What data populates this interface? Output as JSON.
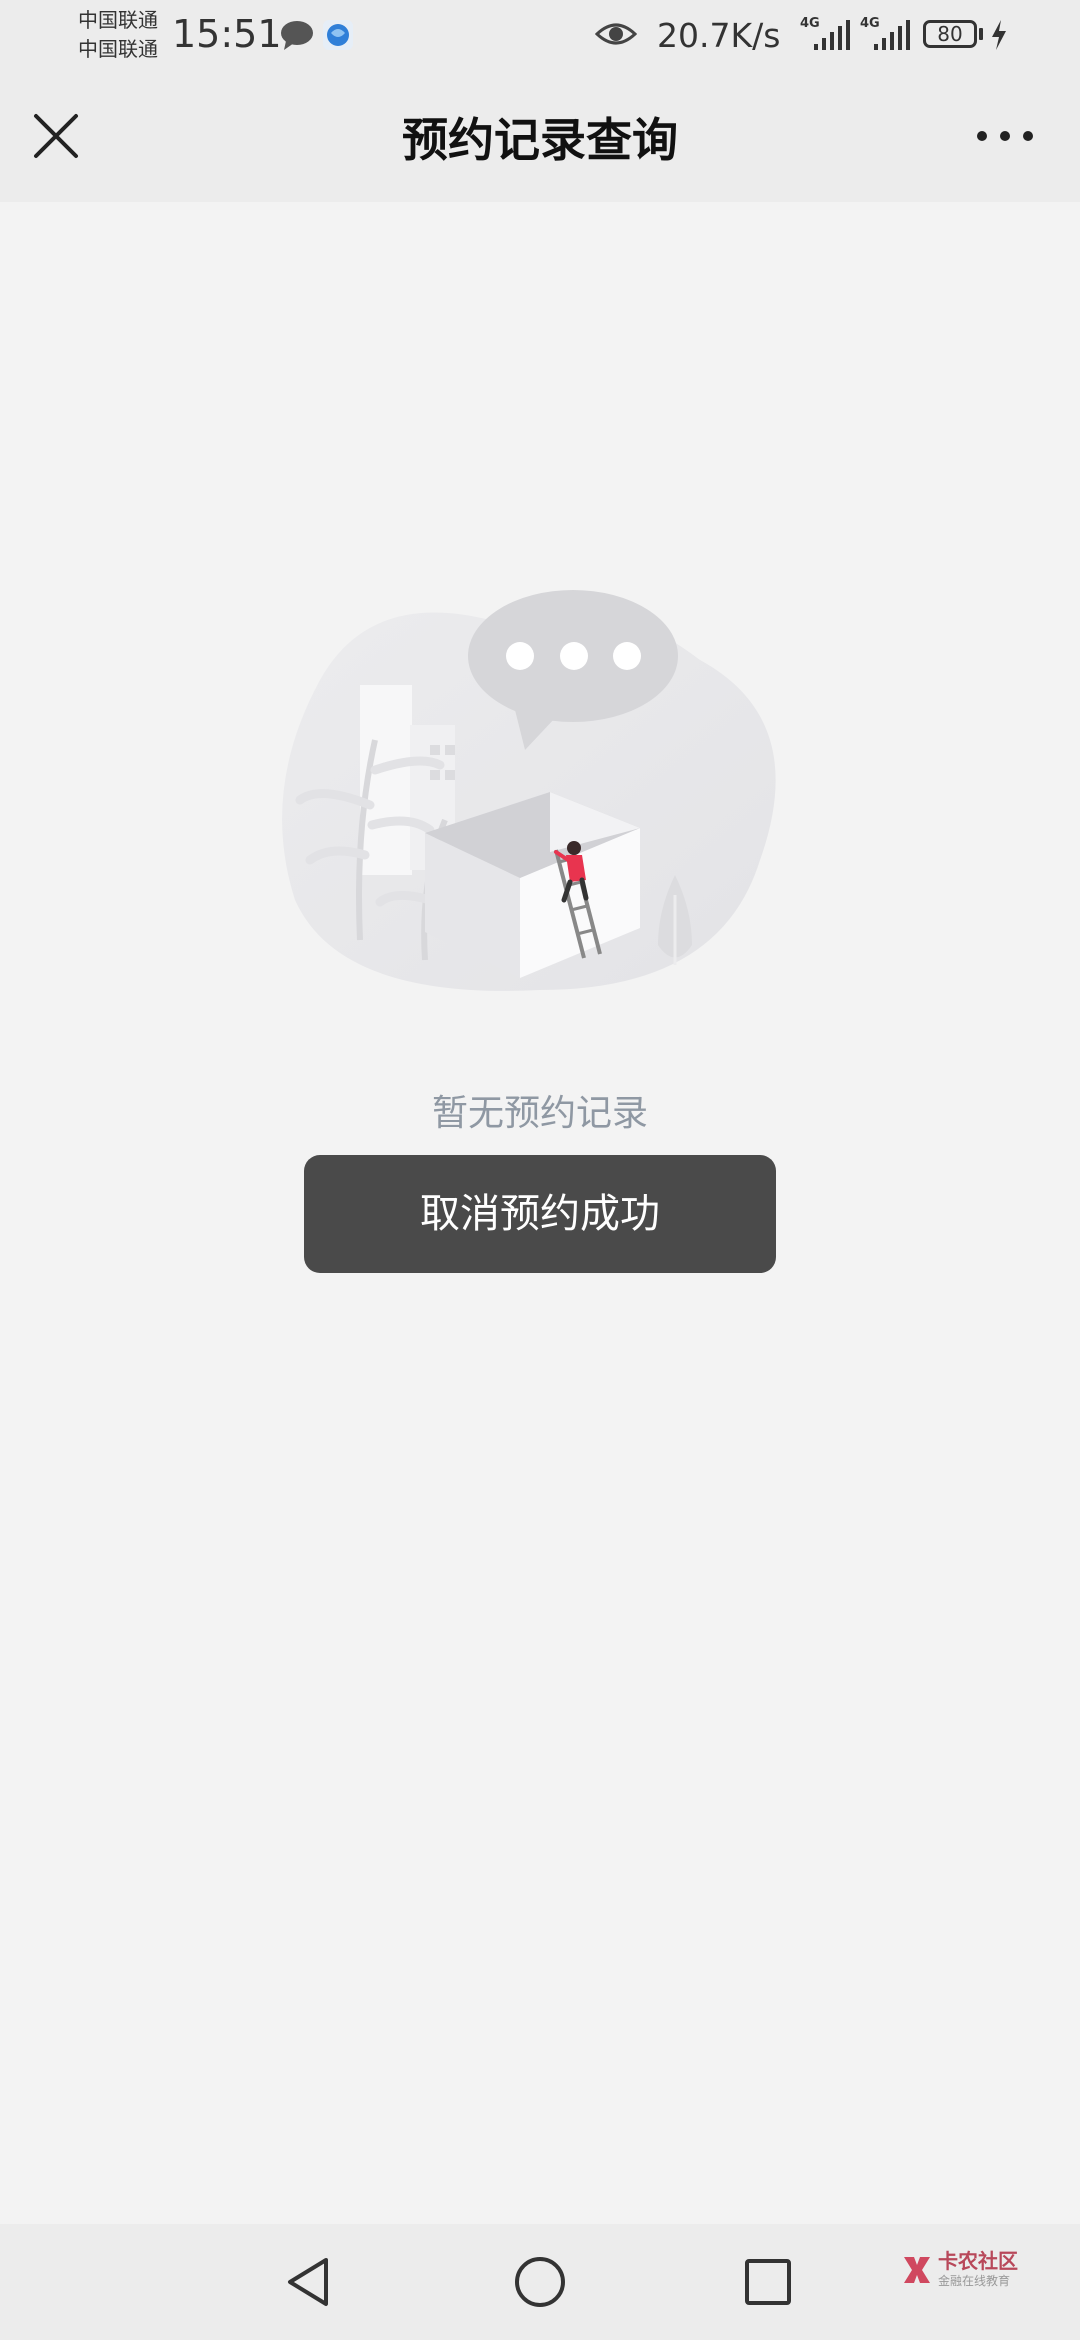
{
  "status_bar": {
    "carrier_1": "中国联通",
    "carrier_2": "中国联通",
    "time": "15:51",
    "network_speed": "20.7K/s",
    "signal_1_label": "4G",
    "signal_2_label": "4G",
    "battery_level": "80",
    "icons": [
      "message-bubble-icon",
      "browser-app-icon",
      "eye-icon",
      "signal-icon",
      "signal-icon",
      "battery-icon",
      "charging-icon"
    ]
  },
  "header": {
    "title": "预约记录查询",
    "close_icon": "close-icon",
    "more_icon": "more-dots-icon"
  },
  "main": {
    "empty_text": "暂无预约记录",
    "illustration": "empty-state-illustration"
  },
  "toast": {
    "message": "取消预约成功"
  },
  "bottom_nav": {
    "icons": [
      "back-triangle-icon",
      "home-circle-icon",
      "recents-square-icon"
    ],
    "watermark_title": "卡农社区",
    "watermark_subtitle": "金融在线教育"
  },
  "colors": {
    "background": "#f3f3f3",
    "bar_background": "#ececec",
    "toast_background": "#4a4a4a",
    "empty_text": "#8f98a3",
    "watermark_accent": "#b8485a"
  }
}
